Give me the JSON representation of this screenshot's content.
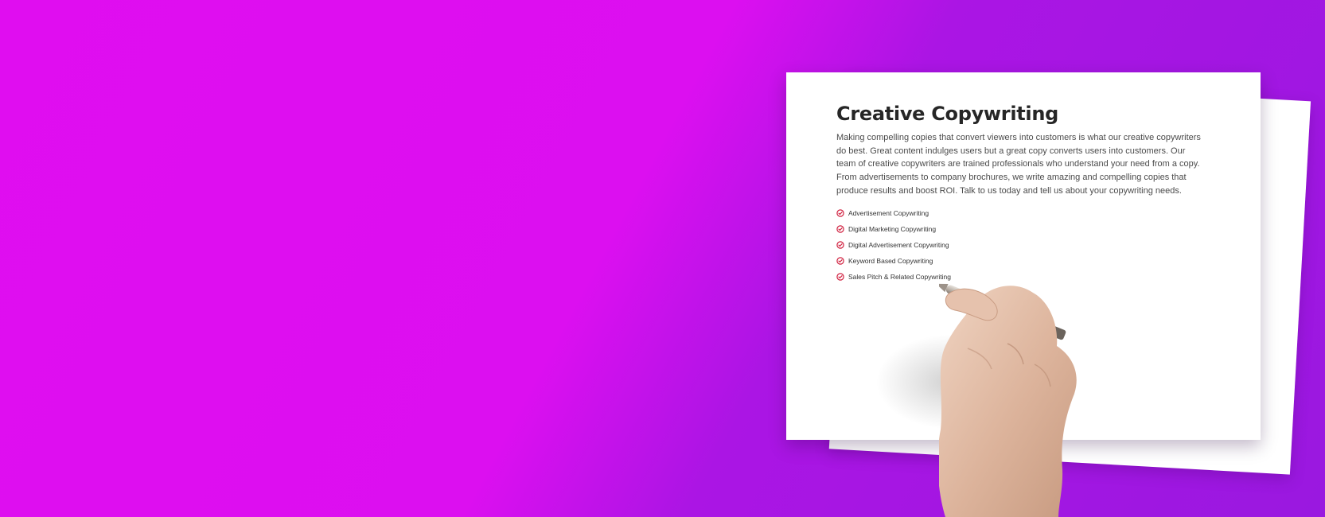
{
  "hero": {
    "colors": {
      "gradient_start": "#e00df0",
      "gradient_end": "#9a18e0",
      "check_icon": "#d0203f",
      "title_text": "#262626"
    }
  },
  "card": {
    "title": "Creative Copywriting",
    "body": "Making compelling copies that convert viewers into customers is what our creative copywriters do best. Great content indulges users but a great copy converts users into customers. Our team of creative copywriters are trained professionals who understand your need from a copy. From advertisements to company brochures, we write amazing and compelling copies that produce results and boost ROI. Talk to us today and tell us about your copywriting needs.",
    "services": [
      {
        "label": "Advertisement Copywriting",
        "icon": "check-circle-icon"
      },
      {
        "label": "Digital Marketing Copywriting",
        "icon": "check-circle-icon"
      },
      {
        "label": "Digital Advertisement Copywriting",
        "icon": "check-circle-icon"
      },
      {
        "label": "Keyword Based Copywriting",
        "icon": "check-circle-icon"
      },
      {
        "label": "Sales Pitch & Related Copywriting",
        "icon": "check-circle-icon"
      }
    ]
  },
  "illustration": {
    "icon": "hand-holding-pen"
  }
}
